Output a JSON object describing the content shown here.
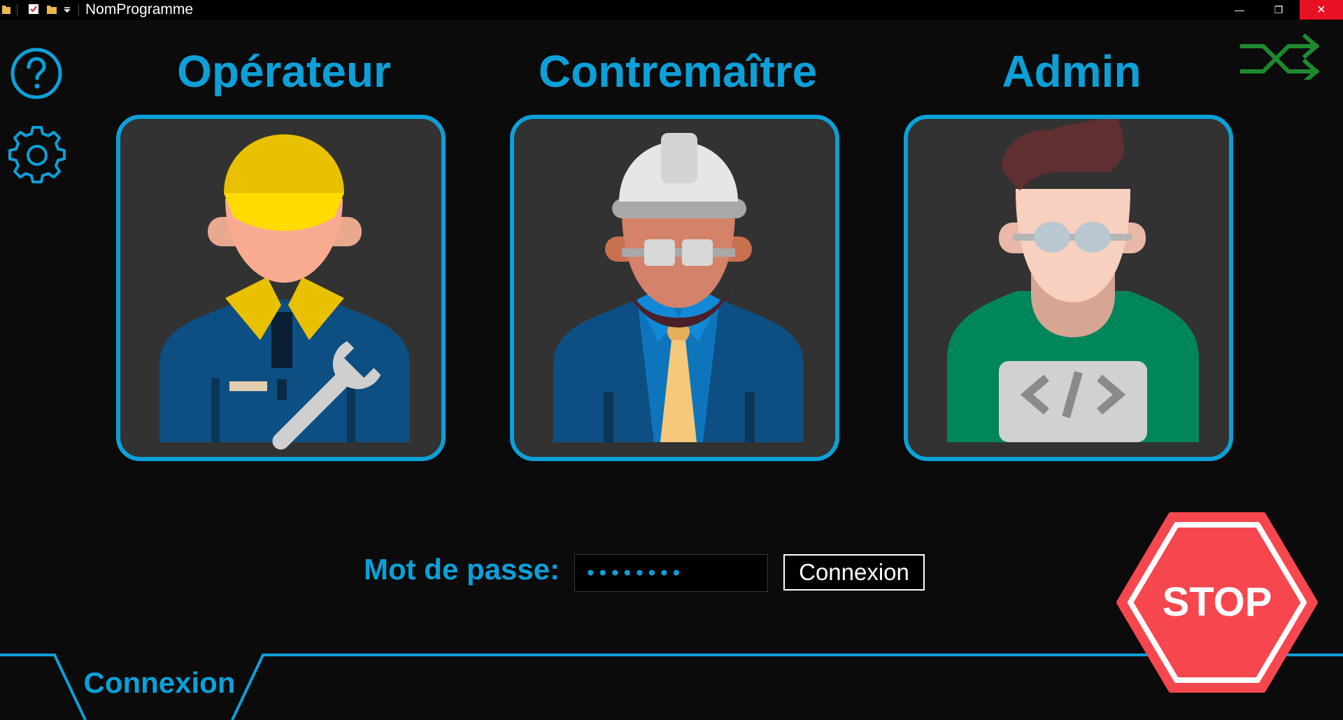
{
  "window": {
    "title": "NomProgramme",
    "minimize_glyph": "—",
    "restore_glyph": "❐",
    "close_glyph": "✕"
  },
  "toolbar": {
    "help_icon": "help-circle-icon",
    "settings_icon": "gear-icon",
    "switch_icon": "shuffle-icon"
  },
  "roles": [
    {
      "label": "Opérateur",
      "icon": "operator-worker-icon"
    },
    {
      "label": "Contremaître",
      "icon": "foreman-engineer-icon"
    },
    {
      "label": "Admin",
      "icon": "admin-developer-icon"
    }
  ],
  "login": {
    "password_label": "Mot de passe:",
    "password_value": "••••••••",
    "connect_label": "Connexion"
  },
  "tab": {
    "label": "Connexion"
  },
  "stop": {
    "label": "STOP"
  },
  "colors": {
    "accent": "#0ca0d8",
    "background": "#0b0b0b",
    "card": "#323232",
    "stop_red": "#f5474d",
    "switch_green": "#1e8a2e"
  }
}
